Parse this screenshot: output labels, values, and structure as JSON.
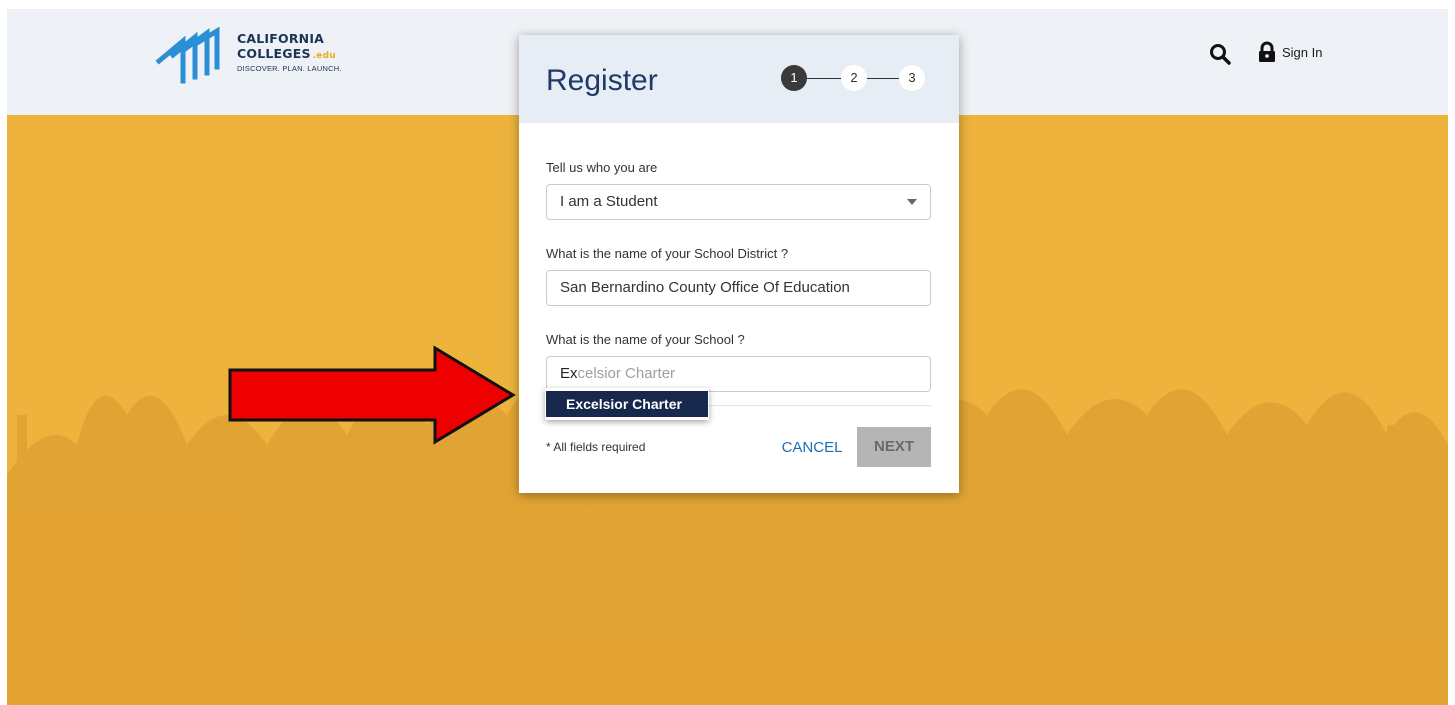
{
  "brand": {
    "line1": "CALIFORNIA",
    "line2": "COLLEGES",
    "suffix": ".edu",
    "tagline": "DISCOVER. PLAN. LAUNCH."
  },
  "header": {
    "search_icon": "search-icon",
    "signin_label": "Sign In",
    "signin_icon": "lock-icon"
  },
  "modal": {
    "title": "Register",
    "steps": [
      "1",
      "2",
      "3"
    ],
    "current_step": 1,
    "role_label": "Tell us who you are",
    "role_value": "I am a Student",
    "district_label": "What is the name of your School District ?",
    "district_value": "San Bernardino County Office Of Education",
    "school_label": "What is the name of your School ?",
    "school_typed": "Ex",
    "school_suggestion_rest": "celsior Charter",
    "autocomplete": [
      "Excelsior Charter"
    ],
    "required_note": "* All fields required",
    "cancel_label": "CANCEL",
    "next_label": "NEXT"
  },
  "colors": {
    "hero": "#edb33c",
    "header_bg": "#eef1f5",
    "brand_navy": "#1c3259",
    "link_blue": "#1c6fb5",
    "arrow_red": "#ee0000"
  }
}
